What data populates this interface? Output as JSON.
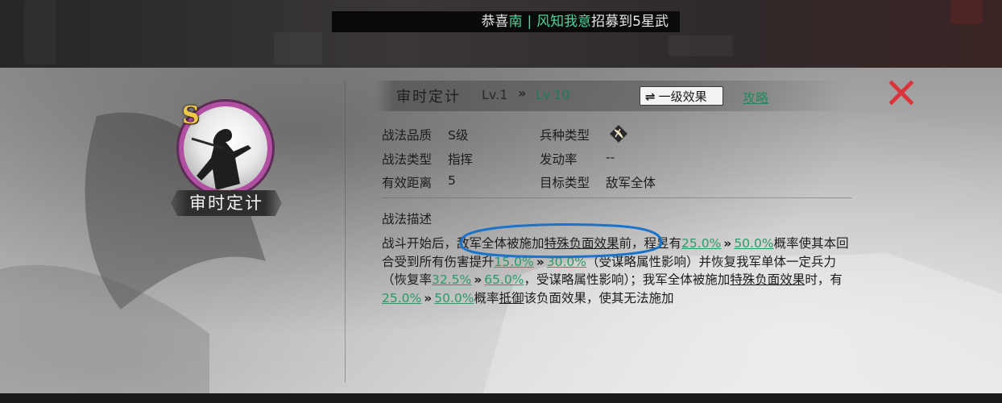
{
  "ticker": {
    "prefix": "恭喜",
    "server": "南",
    "separator": "|",
    "player": "风知我意",
    "suffix": "招募到5星武"
  },
  "skill": {
    "grade": "S",
    "name": "审时定计",
    "level_current": "Lv.1",
    "level_arrow": "»",
    "level_max": "Lv.10"
  },
  "buttons": {
    "effect_icon": "⇌",
    "effect_label": "一级效果",
    "guide_label": "攻略",
    "close_icon": "close-x-icon"
  },
  "attributes": {
    "quality_label": "战法品质",
    "quality_value": "S级",
    "troop_label": "兵种类型",
    "troop_icon": "bow-icon",
    "type_label": "战法类型",
    "type_value": "指挥",
    "rate_label": "发动率",
    "rate_value": "--",
    "range_label": "有效距离",
    "range_value": "5",
    "target_label": "目标类型",
    "target_value": "敌军全体"
  },
  "description": {
    "title": "战法描述",
    "p1": "战斗开始后，敌军全体被施加",
    "p1_u": "特殊负面效果",
    "p2": "前，程昱有",
    "v1a": "25.0%",
    "v1b": "50.0%",
    "p3": "概率使其本回合受到所有伤害提升",
    "v2a": "15.0%",
    "v2b": "30.0%",
    "p4": "（受谋略属性影响）并恢复我军单体一定兵力（恢复率",
    "v3a": "32.5%",
    "v3b": "65.0%",
    "p5": "，受谋略属性影响）；我军全体被施加",
    "p5_u": "特殊负面效果",
    "p6": "时，有",
    "v4a": "25.0%",
    "v4b": "50.0%",
    "p7": "概率",
    "p7_u": "抵御",
    "p8": "该负面效果，使其无法施加",
    "arrow": "»"
  },
  "colors": {
    "accent_green": "#2a9a66",
    "close_red": "#d8363c",
    "portrait_ring": "#b14fa1",
    "grade_gold": "#f0c64a",
    "annotation_blue": "#1a73c9"
  }
}
